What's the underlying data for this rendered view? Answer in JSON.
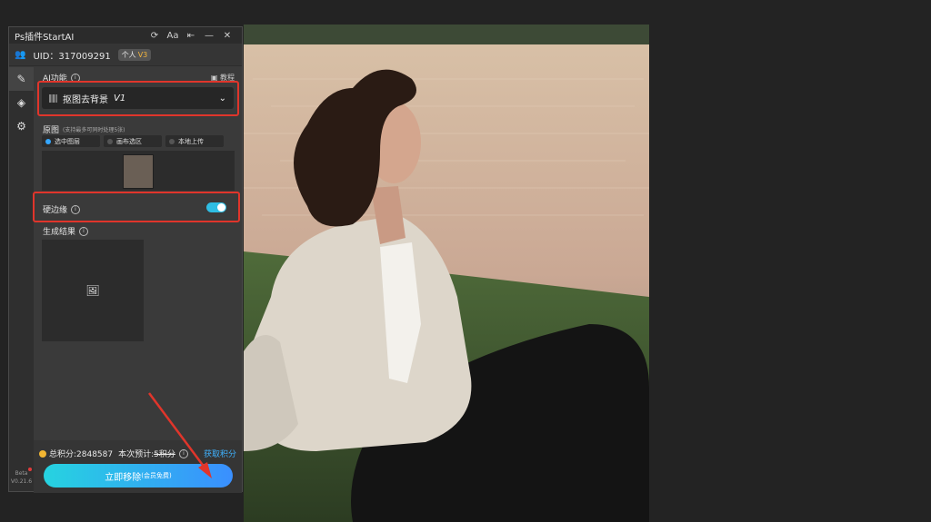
{
  "panel": {
    "title": "Ps插件StartAI",
    "title_icons": [
      "refresh-icon",
      "font-size-icon",
      "pin-icon",
      "minimize-icon",
      "close-icon"
    ],
    "uid_label": "UID：317009291",
    "account_type": "个人",
    "vip_level": "V3"
  },
  "sidebar": {
    "icons": [
      "brush-icon",
      "layers-icon",
      "gear-icon"
    ],
    "version_label": "Beta",
    "version_number": "V0.21.6"
  },
  "ai_feature": {
    "label": "AI功能",
    "tutorial_label": "教程",
    "dropdown_value": "抠图去背景",
    "dropdown_version": "V1"
  },
  "source": {
    "label": "原图",
    "note": "(支持最多可同时处理5张)",
    "options": [
      "选中图层",
      "画布选区",
      "本地上传"
    ],
    "selected_index": 0
  },
  "hard_edge": {
    "label": "硬边缘",
    "enabled": true
  },
  "result": {
    "label": "生成结果"
  },
  "footer": {
    "points_label": "总积分:2848587",
    "estimate_prefix": "本次预计:",
    "estimate_value": "5积分",
    "get_points": "获取积分",
    "action_button": "立即移除",
    "action_note": "(会员免费)"
  },
  "colors": {
    "accent": "#2fbde3",
    "highlight_box": "#e0352b",
    "link": "#3fb2ff",
    "coin": "#f2b632"
  }
}
